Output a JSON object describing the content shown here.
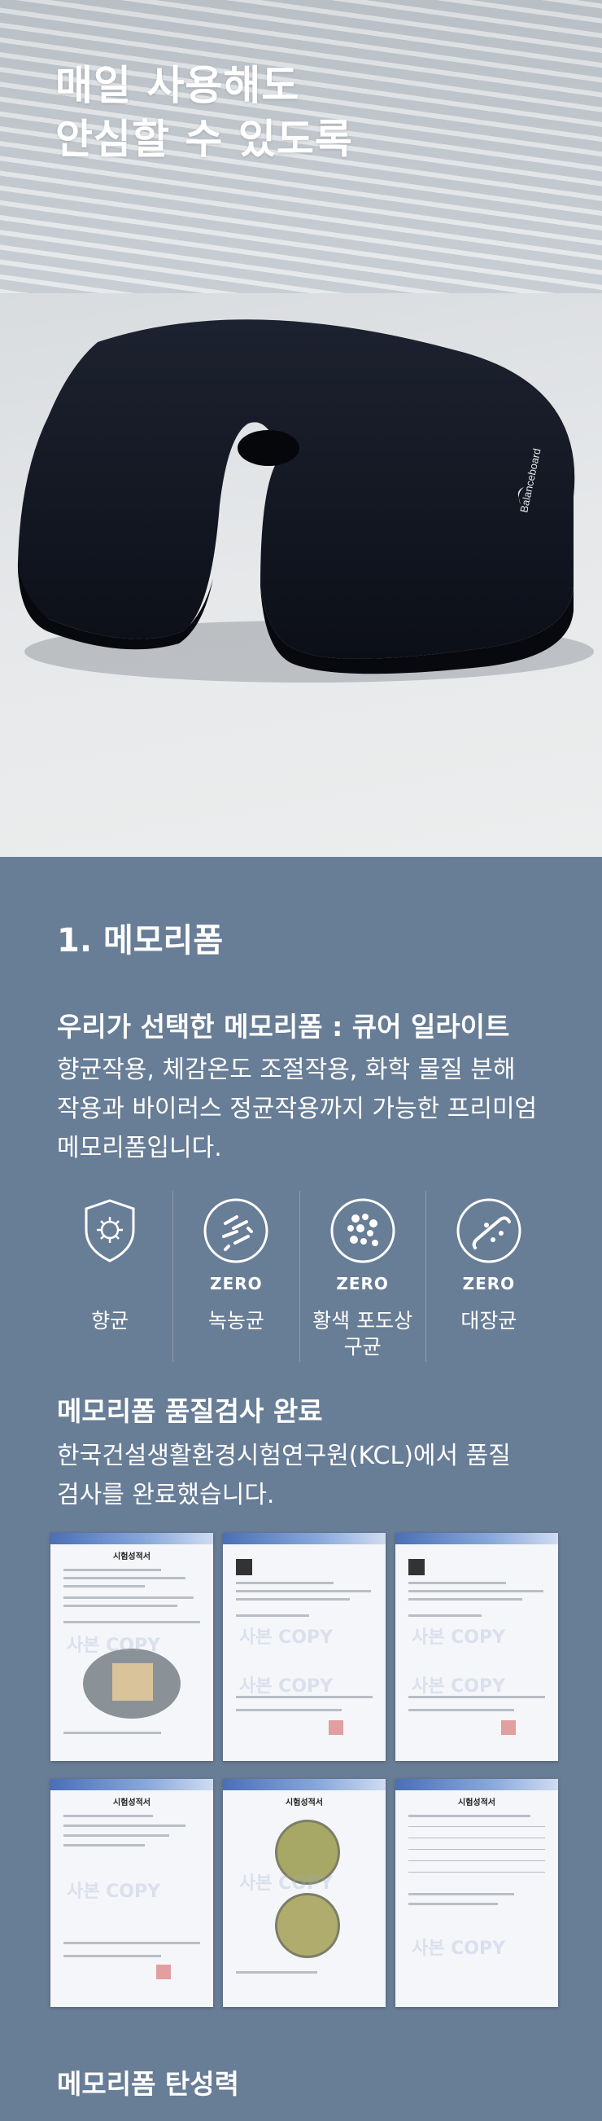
{
  "hero": {
    "title_line1": "매일 사용해도",
    "title_line2": "안심할 수 있도록",
    "product_brand": "Balanceboard"
  },
  "memory_foam": {
    "section_title": "1. 메모리폼",
    "subtitle": "우리가 선택한 메모리폼 : 큐어 일라이트",
    "description_lines": [
      "향균작용, 체감온도 조절작용, 화학 물질 분해",
      "작용과 바이러스 정균작용까지 가능한 프리미엄",
      "메모리폼입니다."
    ],
    "features": [
      {
        "icon": "shield-virus-icon",
        "zero": "",
        "label_lines": [
          "향균"
        ]
      },
      {
        "icon": "bacteria-icon",
        "zero": "ZERO",
        "label_lines": [
          "녹농균"
        ]
      },
      {
        "icon": "staph-cluster-icon",
        "zero": "ZERO",
        "label_lines": [
          "황색 포도상",
          "구균"
        ]
      },
      {
        "icon": "ecoli-icon",
        "zero": "ZERO",
        "label_lines": [
          "대장균"
        ]
      }
    ],
    "quality_title": "메모리폼 품질검사 완료",
    "quality_lines": [
      "한국건설생활환경시험연구원(KCL)에서 품질",
      "검사를 완료했습니다."
    ],
    "certificate_title": "시험성적서",
    "certificate_watermark": "사본 COPY",
    "elasticity_title": "메모리폼 탄성력"
  },
  "colors": {
    "section_bg": "#687d96",
    "text": "#ffffff"
  }
}
